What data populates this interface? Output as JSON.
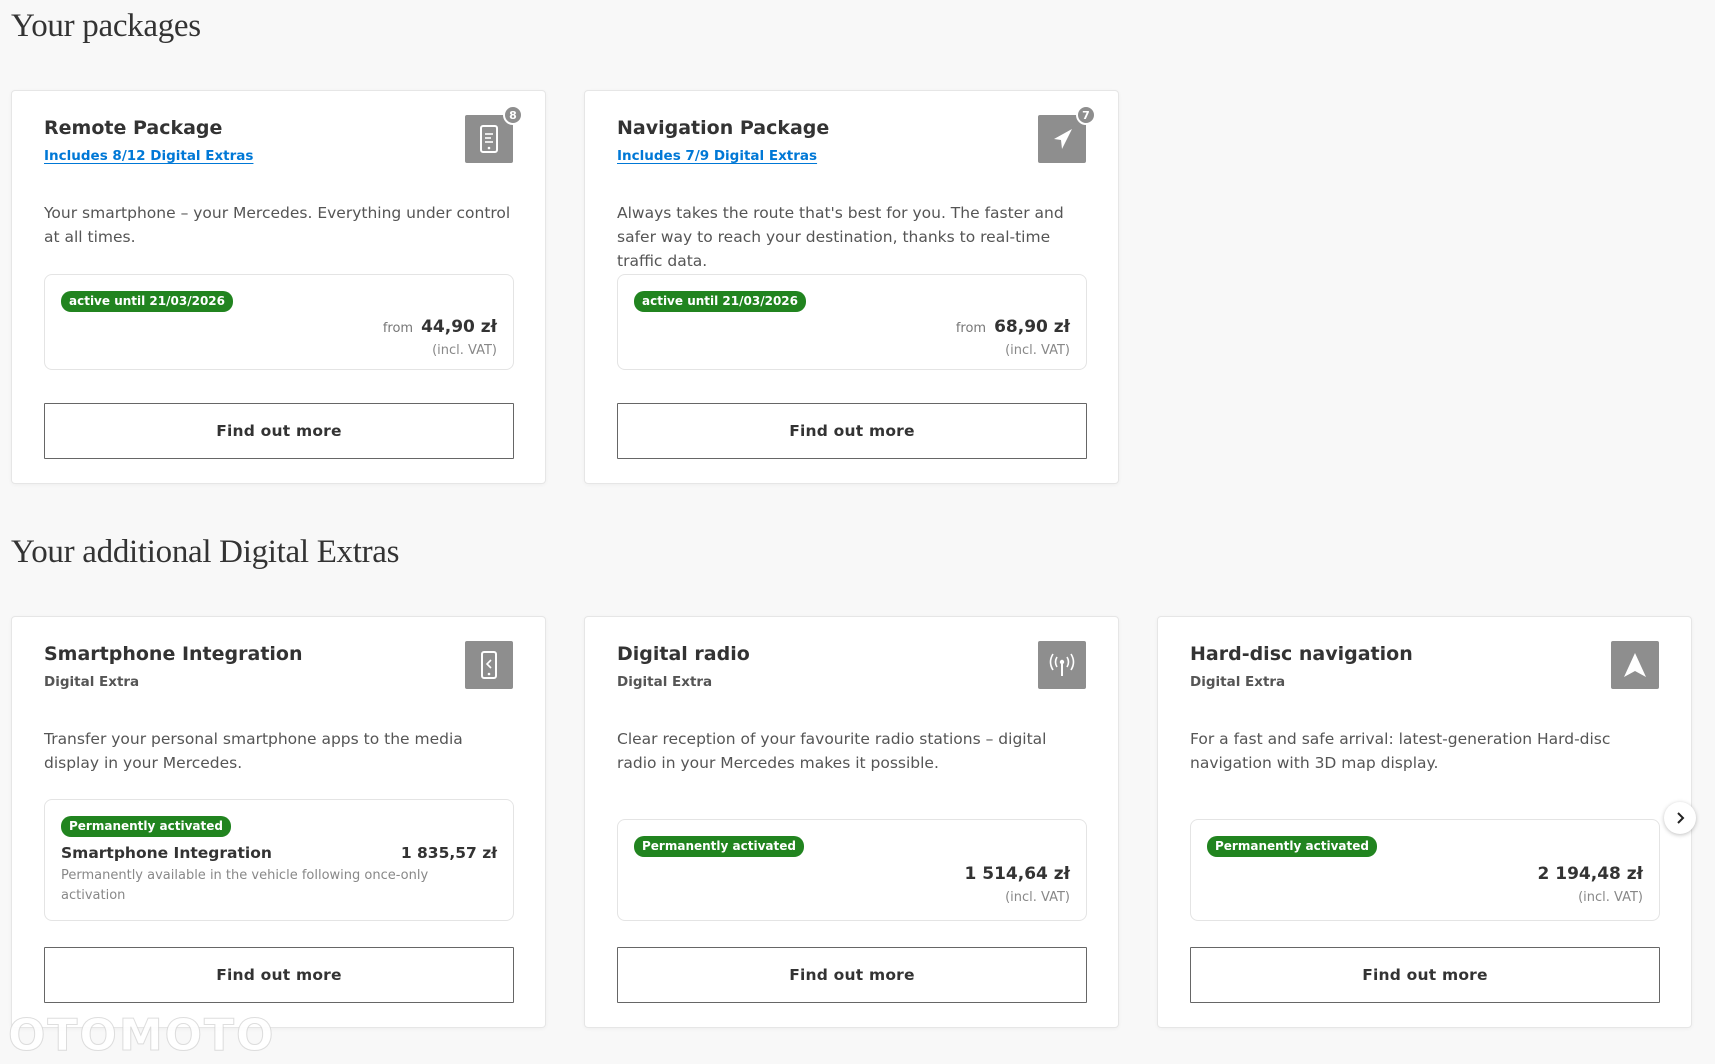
{
  "sections": {
    "packages_title": "Your packages",
    "extras_title": "Your additional Digital Extras"
  },
  "packages": [
    {
      "title": "Remote Package",
      "subtitle": "Includes 8/12 Digital Extras",
      "icon": "phone-remote-icon",
      "badge_count": "8",
      "description": "Your smartphone – your Mercedes. Everything under control at all times.",
      "status": "active until 21/03/2026",
      "price_prefix": "from",
      "price": "44,90 zł",
      "vat_note": "(incl. VAT)",
      "button": "Find out more"
    },
    {
      "title": "Navigation Package",
      "subtitle": "Includes 7/9 Digital Extras",
      "icon": "navigation-arrow-icon",
      "badge_count": "7",
      "description": "Always takes the route that's best for you. The faster and safer way to reach your destination, thanks to real-time traffic data.",
      "status": "active until 21/03/2026",
      "price_prefix": "from",
      "price": "68,90 zł",
      "vat_note": "(incl. VAT)",
      "button": "Find out more"
    }
  ],
  "extras": [
    {
      "title": "Smartphone Integration",
      "subtitle": "Digital Extra",
      "icon": "smartphone-icon",
      "description": "Transfer your personal smartphone apps to the media display in your Mercedes.",
      "status": "Permanently activated",
      "detail_name": "Smartphone Integration",
      "price": "1 835,57 zł",
      "detail_note": "Permanently available in the vehicle following once-only activation",
      "button": "Find out more"
    },
    {
      "title": "Digital radio",
      "subtitle": "Digital Extra",
      "icon": "radio-antenna-icon",
      "description": "Clear reception of your favourite radio stations – digital radio in your Mercedes makes it possible.",
      "status": "Permanently activated",
      "price": "1 514,64 zł",
      "vat_note": "(incl. VAT)",
      "button": "Find out more"
    },
    {
      "title": "Hard-disc navigation",
      "subtitle": "Digital Extra",
      "icon": "navigation-pointer-icon",
      "description": "For a fast and safe arrival: latest-generation Hard-disc navigation with 3D map display.",
      "status": "Permanently activated",
      "price": "2 194,48 zł",
      "vat_note": "(incl. VAT)",
      "button": "Find out more"
    }
  ],
  "carousel": {
    "next_icon": "chevron-right-icon"
  },
  "watermark": "OTOMOTO",
  "colors": {
    "status_green": "#21841f",
    "link_blue": "#0078d6",
    "icon_gray": "#8e8e8e"
  }
}
